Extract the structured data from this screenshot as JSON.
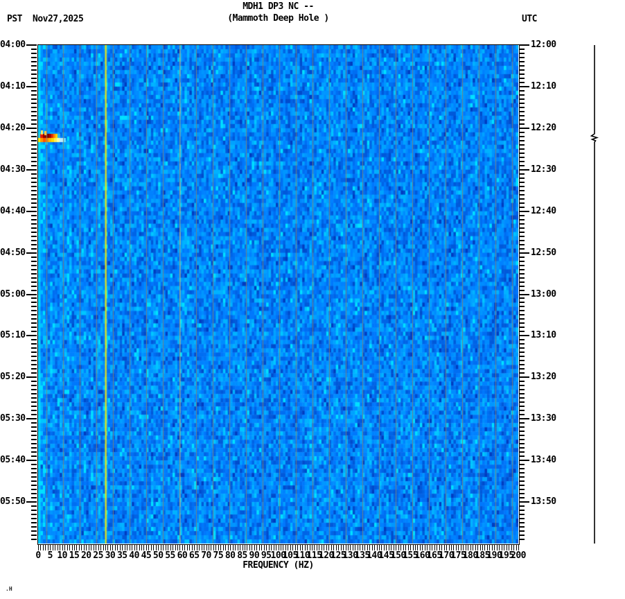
{
  "header": {
    "title": "MDH1 DP3 NC --",
    "subtitle": "(Mammoth Deep Hole )",
    "left_timezone": "PST",
    "date": "Nov27,2025",
    "right_timezone": "UTC"
  },
  "corner_mark": ".H",
  "chart_data": {
    "type": "heatmap",
    "subtype": "seismic spectrogram",
    "title": "MDH1 DP3 NC --",
    "subtitle": "(Mammoth Deep Hole )",
    "station": {
      "station": "MDH1",
      "channel": "DP3",
      "network": "NC",
      "location": "--",
      "site_name": "Mammoth Deep Hole"
    },
    "xlabel": "FREQUENCY (HZ)",
    "x_axis": {
      "unit": "Hz",
      "min": 0,
      "max": 200,
      "label_step": 5,
      "minor_tick_step": 1,
      "tick_labels": [
        "0",
        "5",
        "10",
        "15",
        "20",
        "25",
        "30",
        "35",
        "40",
        "45",
        "50",
        "55",
        "60",
        "65",
        "70",
        "75",
        "80",
        "85",
        "90",
        "95",
        "100",
        "105",
        "110",
        "115",
        "120",
        "125",
        "130",
        "135",
        "140",
        "145",
        "150",
        "155",
        "160",
        "165",
        "170",
        "175",
        "180",
        "185",
        "190",
        "195",
        "200"
      ]
    },
    "y_axis_left": {
      "timezone": "PST",
      "date": "Nov27,2025",
      "start": "04:00",
      "end": "06:00",
      "label_step_min": 10,
      "minor_tick_step_min": 1,
      "tick_labels": [
        "04:00",
        "04:10",
        "04:20",
        "04:30",
        "04:40",
        "04:50",
        "05:00",
        "05:10",
        "05:20",
        "05:30",
        "05:40",
        "05:50"
      ]
    },
    "y_axis_right": {
      "timezone": "UTC",
      "start": "12:00",
      "end": "14:00",
      "label_step_min": 10,
      "minor_tick_step_min": 1,
      "tick_labels": [
        "12:00",
        "12:10",
        "12:20",
        "12:30",
        "12:40",
        "12:50",
        "13:00",
        "13:10",
        "13:20",
        "13:30",
        "13:40",
        "13:50"
      ]
    },
    "time_span_minutes": 120,
    "colors": {
      "background_blue": "#0078fc",
      "bright_cyan": "#00e0ff",
      "dark_blue": "#003cc0",
      "grid_line": "#7d8278",
      "line_28hz": "#ffe800",
      "line_59hz": "#ffeb8c",
      "event_core": "#8b0000",
      "event_red": "#e81800",
      "event_orange": "#ff8800",
      "event_yellow": "#ffee00"
    },
    "features": [
      {
        "type": "event",
        "description": "High-amplitude broadband burst (earthquake)",
        "time_pst": "04:22",
        "time_utc": "12:22",
        "freq_range_hz": [
          0,
          12
        ]
      },
      {
        "type": "persistent_tone",
        "freq_hz": 28,
        "description": "Continuous narrow-band yellow line across full time span"
      },
      {
        "type": "persistent_tone",
        "freq_hz": 59,
        "description": "Faint narrow-band line (power hum)"
      },
      {
        "type": "band",
        "freq_range_hz": [
          0,
          1
        ],
        "description": "Bright cyan band at lowest frequencies"
      }
    ],
    "grid": {
      "vertical_separator_spacing_px": 24
    }
  }
}
